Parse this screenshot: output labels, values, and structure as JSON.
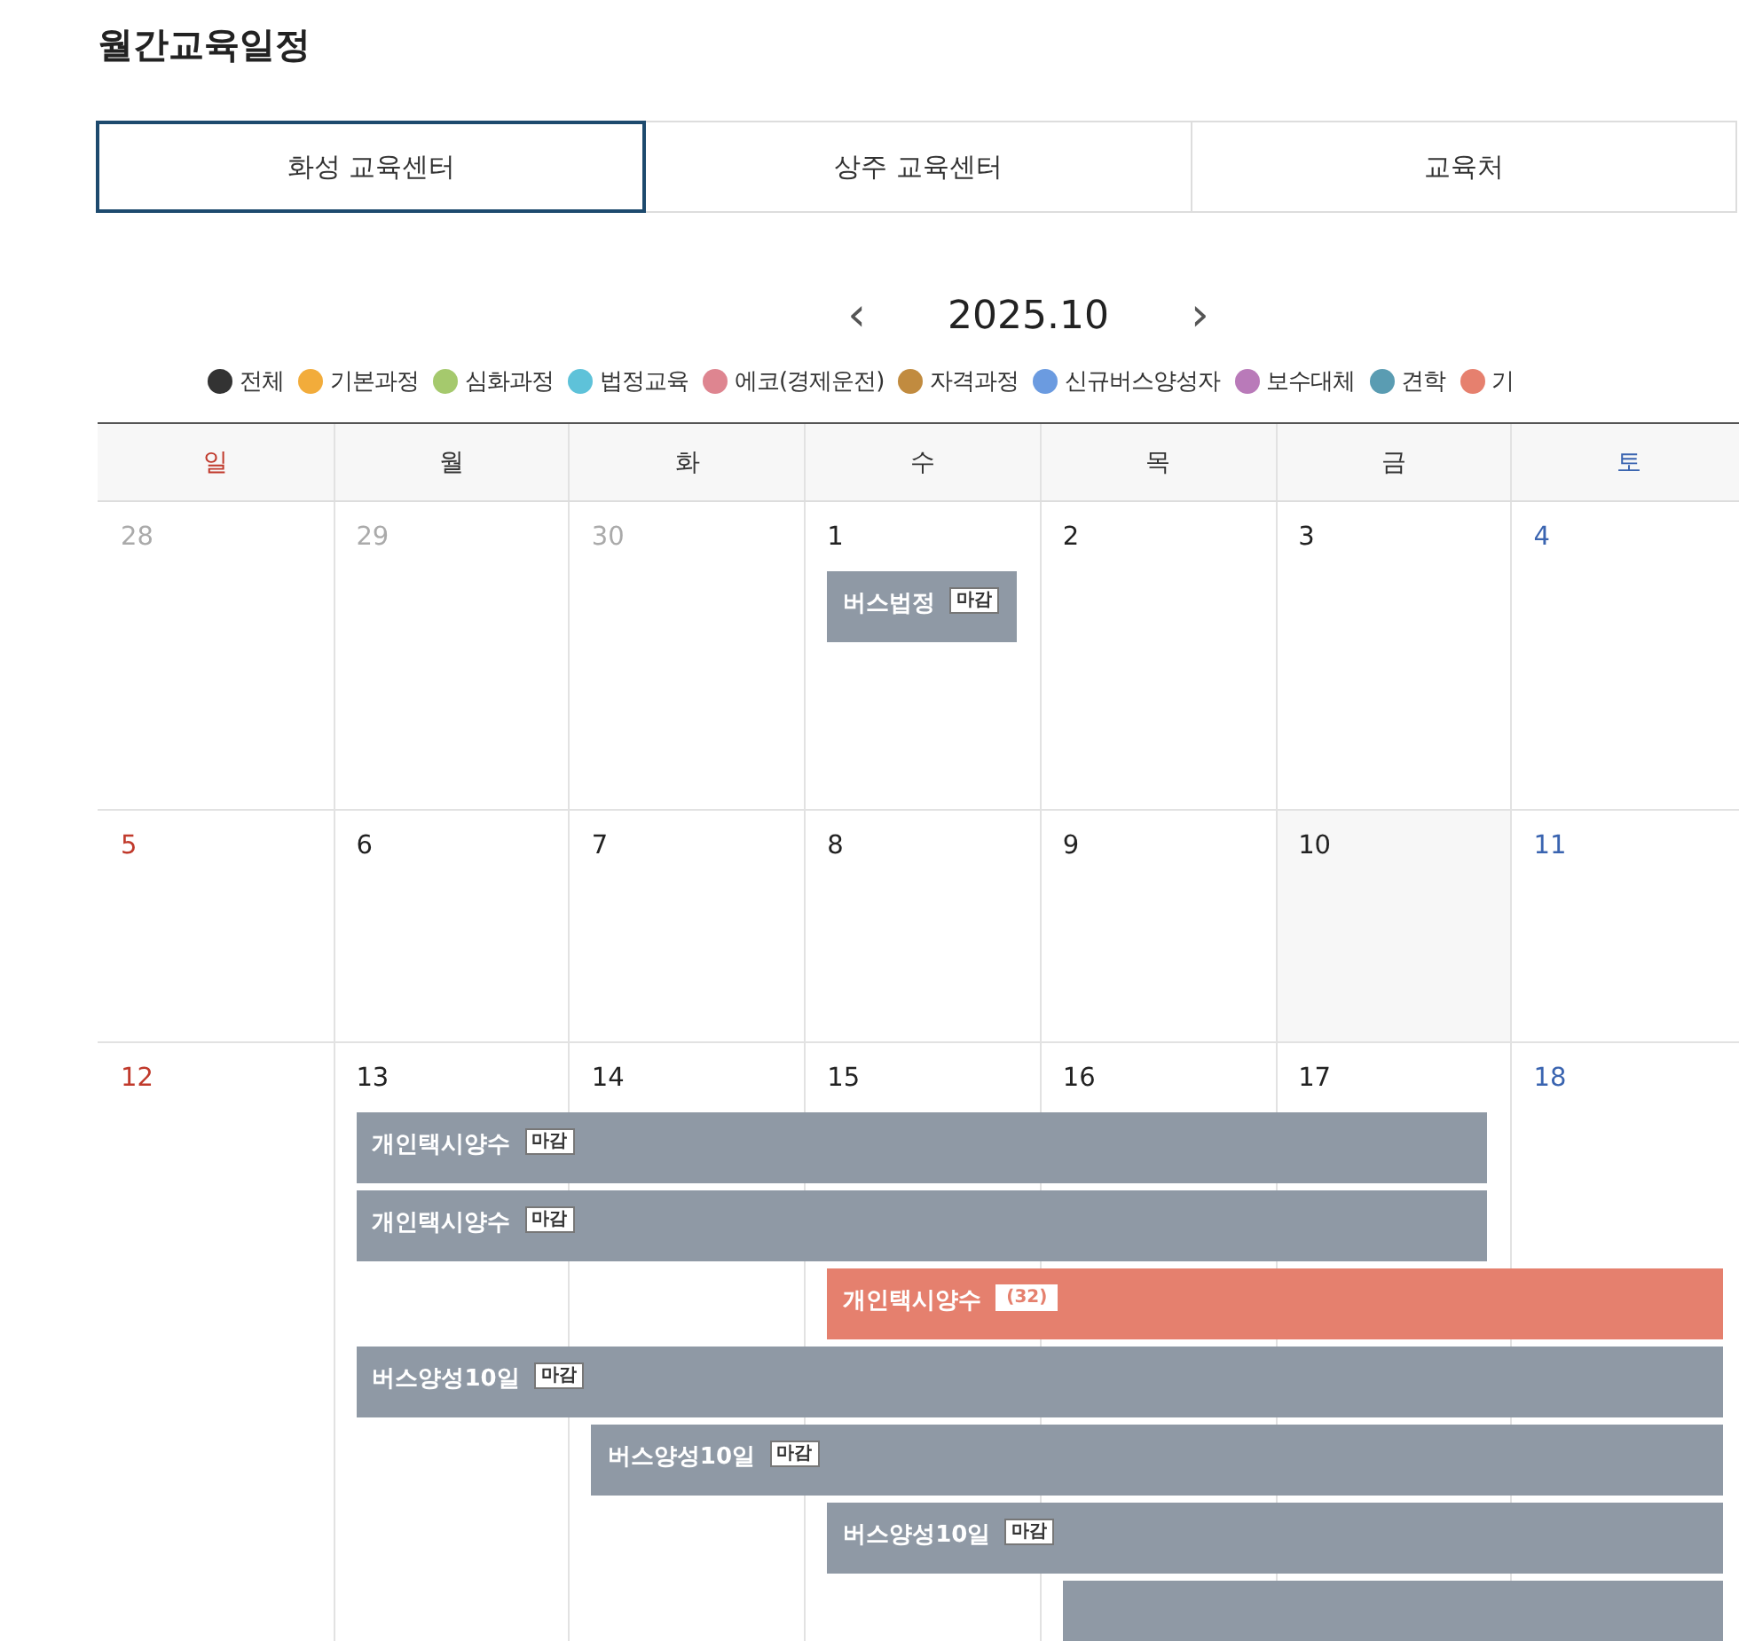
{
  "page_title": "월간교육일정",
  "tabs": [
    {
      "label": "화성 교육센터",
      "selected": true
    },
    {
      "label": "상주 교육센터",
      "selected": false
    },
    {
      "label": "교육처",
      "selected": false
    }
  ],
  "month_nav": {
    "prev": "‹",
    "month": "2025.10",
    "next": "›"
  },
  "legend": [
    {
      "label": "전체",
      "color": "#333333"
    },
    {
      "label": "기본과정",
      "color": "#f2ac3b"
    },
    {
      "label": "심화과정",
      "color": "#a5c96d"
    },
    {
      "label": "법정교육",
      "color": "#5ec2d9"
    },
    {
      "label": "에코(경제운전)",
      "color": "#de8590"
    },
    {
      "label": "자격과정",
      "color": "#c18b3f"
    },
    {
      "label": "신규버스양성자",
      "color": "#6b9be0"
    },
    {
      "label": "보수대체",
      "color": "#b97ab9"
    },
    {
      "label": "견학",
      "color": "#5a9cb2"
    },
    {
      "label": "기",
      "color": "#e6806e"
    }
  ],
  "weekdays": [
    {
      "label": "일",
      "kind": "sunday"
    },
    {
      "label": "월",
      "kind": "weekday"
    },
    {
      "label": "화",
      "kind": "weekday"
    },
    {
      "label": "수",
      "kind": "weekday"
    },
    {
      "label": "목",
      "kind": "weekday"
    },
    {
      "label": "금",
      "kind": "weekday"
    },
    {
      "label": "토",
      "kind": "saturday"
    }
  ],
  "weeks": [
    {
      "days": [
        {
          "day": "28",
          "other_month": true
        },
        {
          "day": "29",
          "other_month": true
        },
        {
          "day": "30",
          "other_month": true
        },
        {
          "day": "1",
          "other_month": false,
          "slots": [
            {
              "kind": "start",
              "title": "버스법정",
              "tag": "마감",
              "closed": true,
              "color": "#8f99a5"
            }
          ]
        },
        {
          "day": "2",
          "other_month": false
        },
        {
          "day": "3",
          "other_month": false
        },
        {
          "day": "4",
          "other_month": false
        }
      ]
    },
    {
      "days": [
        {
          "day": "5",
          "other_month": false
        },
        {
          "day": "6",
          "other_month": false
        },
        {
          "day": "7",
          "other_month": false
        },
        {
          "day": "8",
          "other_month": false
        },
        {
          "day": "9",
          "other_month": false
        },
        {
          "day": "10",
          "other_month": false,
          "today": true
        },
        {
          "day": "11",
          "other_month": false
        }
      ]
    },
    {
      "days": [
        {
          "day": "12",
          "other_month": false
        },
        {
          "day": "13",
          "other_month": false,
          "slots": [
            {
              "kind": "start",
              "title": "개인택시양수",
              "tag": "마감",
              "closed": true,
              "color": "#8f99a5"
            },
            {
              "kind": "start",
              "title": "개인택시양수",
              "tag": "마감",
              "closed": true,
              "color": "#8f99a5"
            },
            {
              "kind": "empty"
            },
            {
              "kind": "start",
              "title": "버스양성10일",
              "tag": "마감",
              "closed": true,
              "color": "#8f99a5"
            }
          ]
        },
        {
          "day": "14",
          "other_month": false,
          "slots": [
            {
              "kind": "continued"
            },
            {
              "kind": "continued"
            },
            {
              "kind": "empty"
            },
            {
              "kind": "continued"
            },
            {
              "kind": "start",
              "title": "버스양성10일",
              "tag": "마감",
              "closed": true,
              "color": "#8f99a5"
            }
          ]
        },
        {
          "day": "15",
          "other_month": false,
          "slots": [
            {
              "kind": "continued"
            },
            {
              "kind": "continued"
            },
            {
              "kind": "start",
              "title": "개인택시양수",
              "tag": "(32)",
              "closed": false,
              "color": "#e5806e"
            },
            {
              "kind": "continued"
            },
            {
              "kind": "continued"
            },
            {
              "kind": "start",
              "title": "버스양성10일",
              "tag": "마감",
              "closed": true,
              "color": "#8f99a5"
            }
          ]
        },
        {
          "day": "16",
          "other_month": false,
          "slots": [
            {
              "kind": "continued"
            },
            {
              "kind": "continued"
            },
            {
              "kind": "continued"
            },
            {
              "kind": "continued"
            },
            {
              "kind": "continued"
            },
            {
              "kind": "continued"
            },
            {
              "kind": "start",
              "color": "#8f99a5"
            }
          ]
        },
        {
          "day": "17",
          "other_month": false,
          "slots": [
            {
              "kind": "continued"
            },
            {
              "kind": "continued"
            },
            {
              "kind": "continued"
            },
            {
              "kind": "continued"
            },
            {
              "kind": "continued"
            },
            {
              "kind": "continued"
            },
            {
              "kind": "continued"
            }
          ]
        },
        {
          "day": "18",
          "other_month": false,
          "slots": [
            {
              "kind": "empty"
            },
            {
              "kind": "empty"
            },
            {
              "kind": "continued"
            },
            {
              "kind": "continued"
            },
            {
              "kind": "continued"
            },
            {
              "kind": "continued"
            },
            {
              "kind": "continued"
            }
          ]
        }
      ]
    }
  ]
}
